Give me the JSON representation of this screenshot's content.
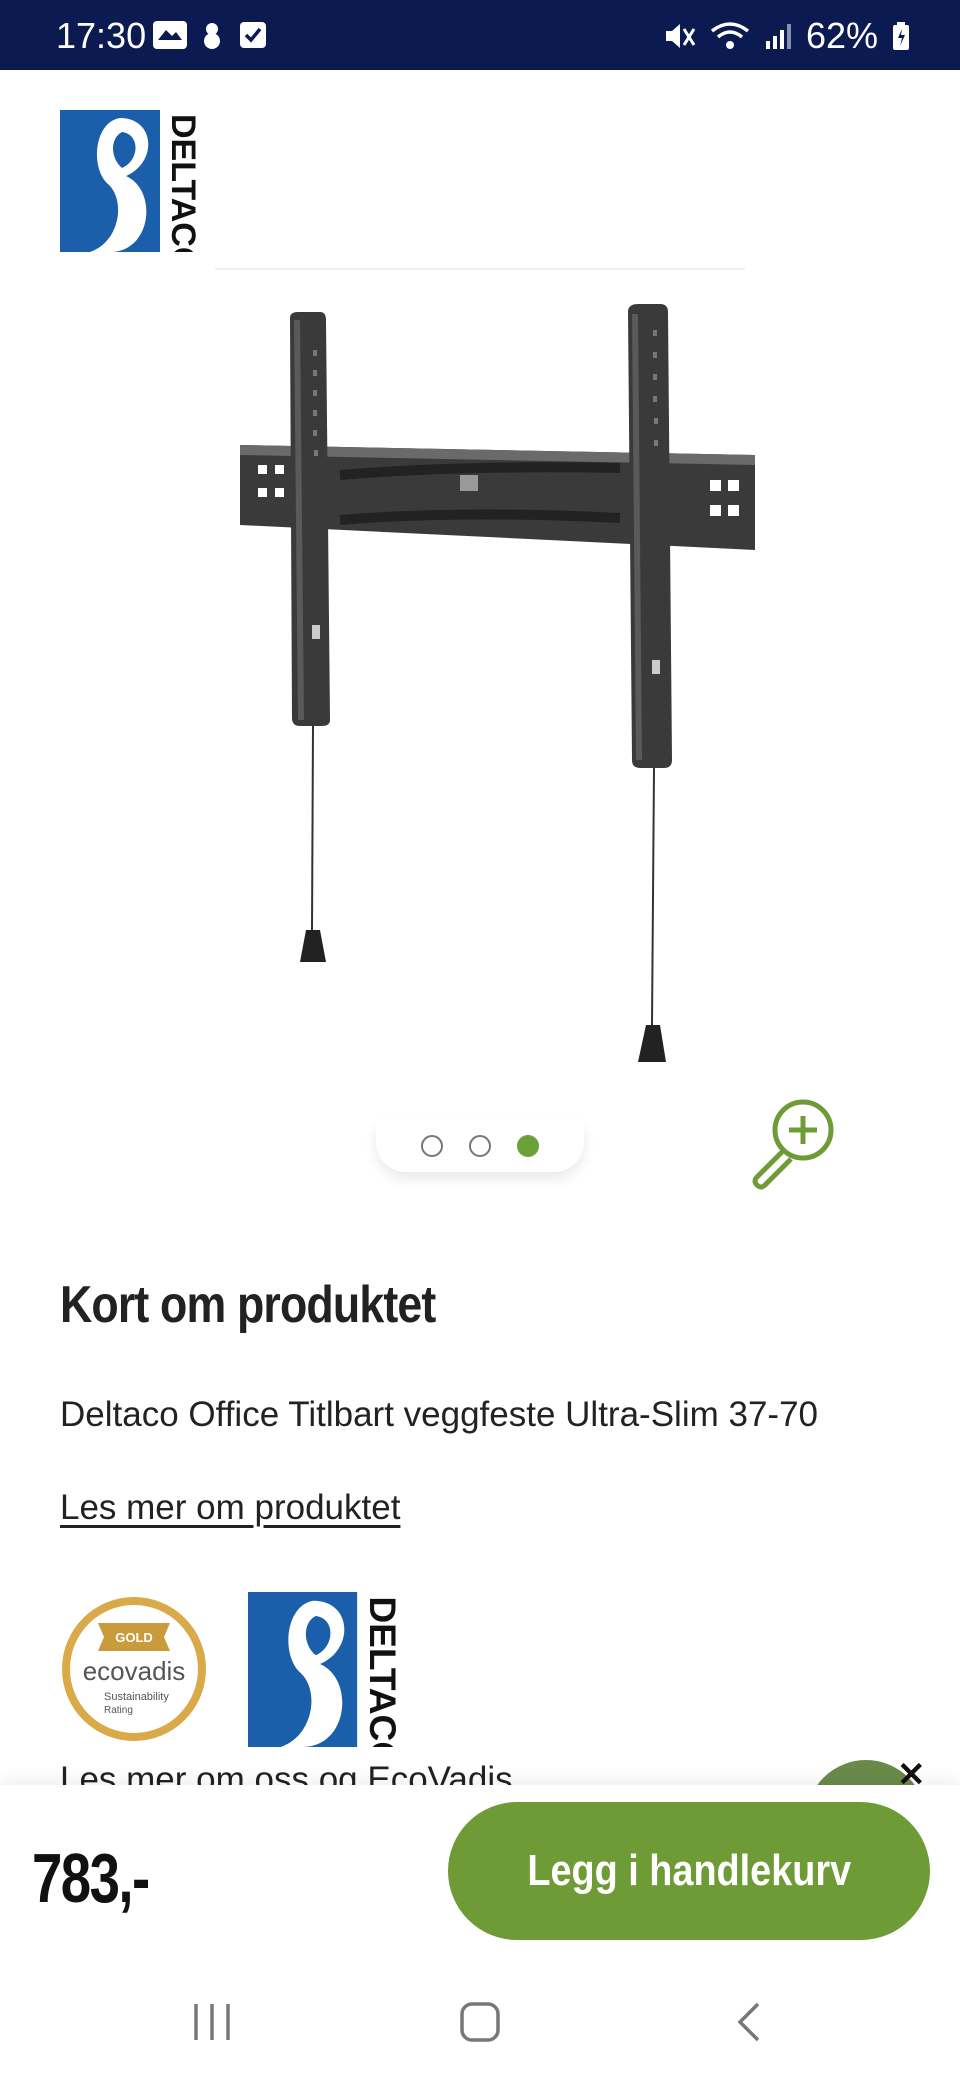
{
  "status_bar": {
    "time": "17:30",
    "battery": "62%",
    "icons": [
      "mydlink-icon",
      "snowman-icon",
      "checkbox-icon",
      "mute-icon",
      "wifi-icon",
      "signal-icon",
      "battery-icon"
    ]
  },
  "brand": {
    "name": "DELTACO"
  },
  "gallery": {
    "dots": 3,
    "active_index": 2
  },
  "content": {
    "section_title": "Kort om produktet",
    "short_description": "Deltaco Office Titlbart veggfeste Ultra-Slim 37-70",
    "read_more": "Les mer om produktet",
    "ecovadis": {
      "badge": "GOLD",
      "brand": "ecovadis",
      "line1": "Sustainability",
      "line2": "Rating"
    },
    "teaser_text": "Les mer om oss og EcoVadis"
  },
  "buy_bar": {
    "price": "783,-",
    "add_to_cart": "Legg i handlekurv"
  },
  "colors": {
    "status_bar_bg": "#0b1b52",
    "accent_green": "#6f9b36",
    "deltaco_blue": "#1b5faa"
  }
}
